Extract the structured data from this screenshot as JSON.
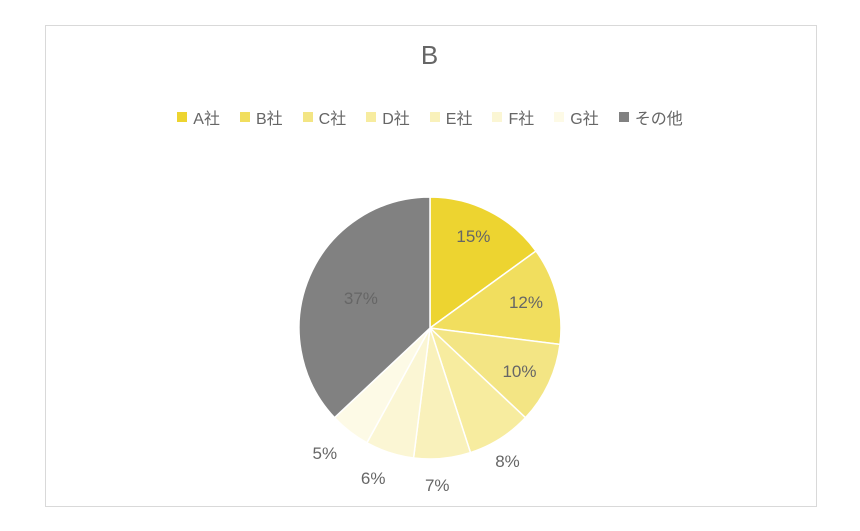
{
  "chart_data": {
    "type": "pie",
    "title": "B",
    "series": [
      {
        "name": "A社",
        "value": 15,
        "label": "15%",
        "color": "#edd430"
      },
      {
        "name": "B社",
        "value": 12,
        "label": "12%",
        "color": "#f1de5e"
      },
      {
        "name": "C社",
        "value": 10,
        "label": "10%",
        "color": "#f3e584"
      },
      {
        "name": "D社",
        "value": 8,
        "label": "8%",
        "color": "#f7ec9f"
      },
      {
        "name": "E社",
        "value": 7,
        "label": "7%",
        "color": "#f9f1bb"
      },
      {
        "name": "F社",
        "value": 6,
        "label": "6%",
        "color": "#fbf6d4"
      },
      {
        "name": "G社",
        "value": 5,
        "label": "5%",
        "color": "#fdfae6"
      },
      {
        "name": "その他",
        "value": 37,
        "label": "37%",
        "color": "#818181"
      }
    ],
    "legend_position": "top",
    "start_angle_deg": -90,
    "direction": "clockwise"
  }
}
